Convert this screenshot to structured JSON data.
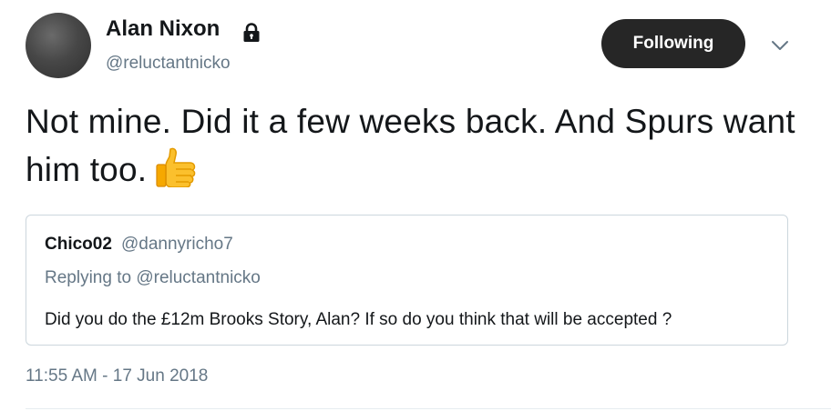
{
  "author": {
    "display_name": "Alan Nixon",
    "handle": "@reluctantnicko",
    "protected_icon": "lock-icon"
  },
  "follow_button": {
    "label": "Following"
  },
  "menu": {
    "icon": "chevron-down-icon"
  },
  "tweet": {
    "text": "Not mine. Did it a few weeks back. And Spurs want him too.",
    "emoji": "thumbs-up-emoji",
    "timestamp": "11:55 AM - 17 Jun 2018"
  },
  "quoted_tweet": {
    "display_name": "Chico02",
    "handle": "@dannyricho7",
    "replying_to": "Replying to @reluctantnicko",
    "text": "Did you do the £12m Brooks Story, Alan? If so do you think that will be accepted ?"
  },
  "colors": {
    "primary_text": "#14171a",
    "secondary_text": "#657786",
    "button_bg": "#262626",
    "border": "#ccd6dd"
  }
}
